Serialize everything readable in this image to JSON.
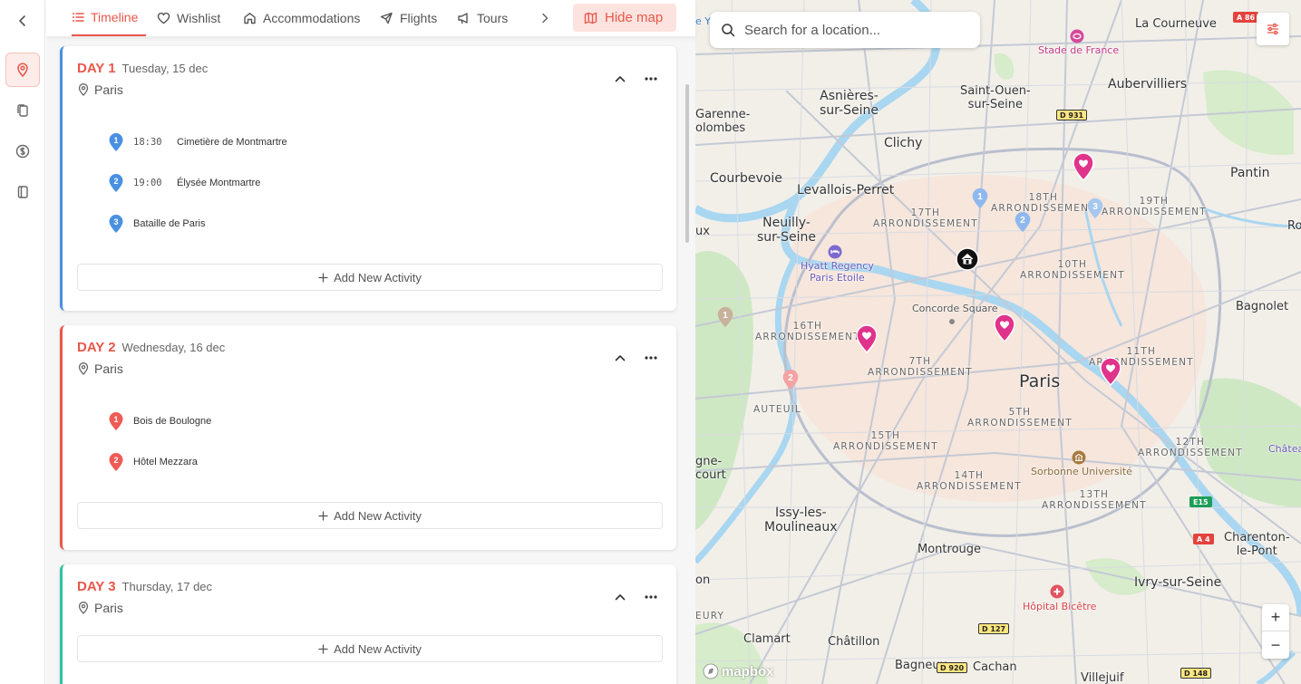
{
  "rail": {
    "items": [
      {
        "icon": "location-pin-icon",
        "active": true
      },
      {
        "icon": "documents-icon",
        "active": false
      },
      {
        "icon": "dollar-icon",
        "active": false
      },
      {
        "icon": "notebook-icon",
        "active": false
      }
    ]
  },
  "tabs": {
    "items": [
      {
        "label": "Timeline",
        "icon": "list-icon",
        "active": true
      },
      {
        "label": "Wishlist",
        "icon": "heart-icon"
      },
      {
        "label": "Accommodations",
        "icon": "home-icon"
      },
      {
        "label": "Flights",
        "icon": "plane-icon"
      },
      {
        "label": "Tours",
        "icon": "megaphone-icon"
      }
    ],
    "hide_map_label": "Hide map"
  },
  "days": [
    {
      "label": "DAY 1",
      "date": "Tuesday, 15 dec",
      "location": "Paris",
      "color": "#4a90e2",
      "activities": [
        {
          "number": "1",
          "time": "18:30",
          "name": "Cimetière de Montmartre"
        },
        {
          "number": "2",
          "time": "19:00",
          "name": "Élysée Montmartre"
        },
        {
          "number": "3",
          "time": "",
          "name": "Bataille de Paris"
        }
      ]
    },
    {
      "label": "DAY 2",
      "date": "Wednesday, 16 dec",
      "location": "Paris",
      "color": "#e8574a",
      "activities": [
        {
          "number": "1",
          "time": "",
          "name": "Bois de Boulogne"
        },
        {
          "number": "2",
          "time": "",
          "name": "Hôtel Mezzara"
        }
      ]
    },
    {
      "label": "DAY 3",
      "date": "Thursday, 17 dec",
      "location": "Paris",
      "color": "#2ec4a0",
      "activities": []
    }
  ],
  "add_activity_label": "Add New Activity",
  "map": {
    "search_placeholder": "Search for a location...",
    "attribution": "mapbox",
    "zoom_in": "+",
    "zoom_out": "−",
    "places": {
      "la_courneuve": "La Courneuve",
      "stade_de_france": "Stade de France",
      "aubervilliers": "Aubervilliers",
      "saint_ouen": "Saint-Ouen-\nsur-Seine",
      "asnieres": "Asnières-\nsur-Seine",
      "garenne": "Garenne-\nolombes",
      "clichy": "Clichy",
      "courbevoie": "Courbevoie",
      "levallois": "Levallois-Perret",
      "pantin": "Pantin",
      "arr_18": "18TH\nARRONDISSEMENT",
      "arr_19": "19TH\nARRONDISSEMENT",
      "arr_17": "17TH\nARRONDISSEMENT",
      "neuilly": "Neuilly-\nsur-Seine",
      "hyatt": "Hyatt Regency\nParis Etoile",
      "arr_10": "10TH\nARRONDISSEMENT",
      "ro": "Ro",
      "bagnolet": "Bagnolet",
      "concorde": "Concorde Square",
      "arr_16": "16TH\nARRONDISSEMENT",
      "arr_7": "7TH\nARRONDISSEMENT",
      "arr_11": "11TH\nARRONDISSEMENT",
      "paris": "Paris",
      "auteuil": "AUTEUIL",
      "arr_5": "5TH\nARRONDISSEMENT",
      "arr_15": "15TH\nARRONDISSEMENT",
      "arr_12": "12TH\nARRONDISSEMENT",
      "chateau": "Châtea",
      "sorbonne": "Sorbonne Université",
      "boulogne": "gne-\ncourt",
      "arr_14": "14TH\nARRONDISSEMENT",
      "arr_13": "13TH\nARRONDISSEMENT",
      "issy": "Issy-les-\nMoulineaux",
      "charenton": "Charenton-\nle-Pont",
      "montrouge": "Montrouge",
      "ivry": "Ivry-sur-Seine",
      "on": "on",
      "hopital": "Hôpital Bicêtre",
      "eury": "EURY",
      "clamart": "Clamart",
      "chatillon": "Châtillon",
      "bagneux": "Bagneux",
      "cachan": "Cachan",
      "villejuif": "Villejuif",
      "ux": "ux",
      "e_y": "e Y"
    },
    "roads": {
      "a86": "A 86",
      "d931": "D 931",
      "e15": "E15",
      "a4": "A 4",
      "d127": "D 127",
      "d920": "D 920",
      "d148": "D 148"
    }
  }
}
